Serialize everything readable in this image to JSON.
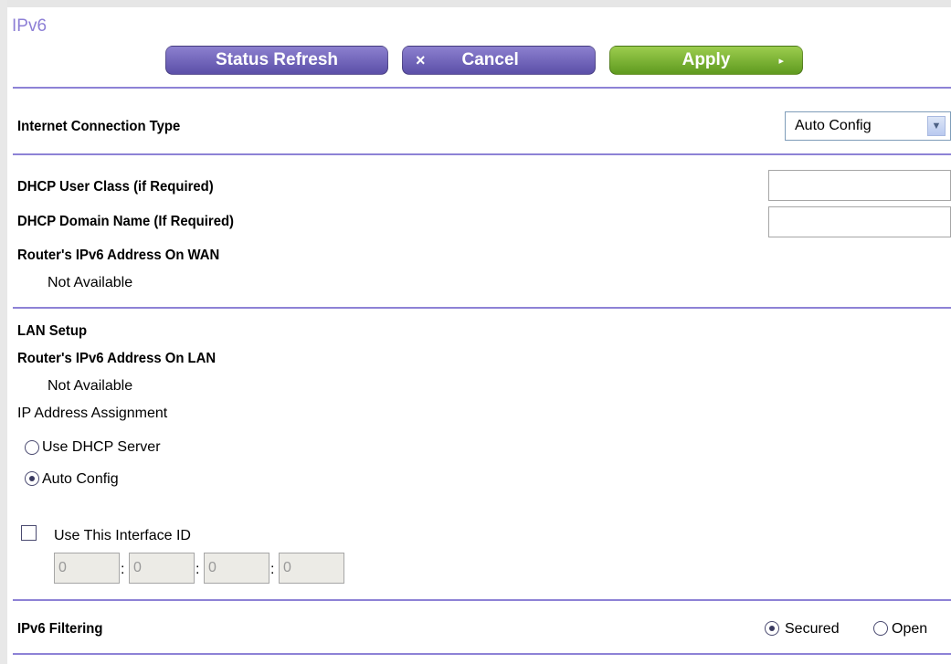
{
  "page": {
    "title": "IPv6"
  },
  "toolbar": {
    "refresh_label": "Status Refresh",
    "cancel_label": "Cancel",
    "cancel_icon": "×",
    "apply_label": "Apply",
    "apply_icon": "▸"
  },
  "connection": {
    "label": "Internet Connection Type",
    "selected": "Auto Config"
  },
  "dhcp": {
    "user_class_label": "DHCP User Class (if Required)",
    "user_class_value": "",
    "domain_label": "DHCP Domain Name  (If Required)",
    "domain_value": "",
    "wan_addr_label": "Router's IPv6 Address On WAN",
    "wan_addr_value": "Not Available"
  },
  "lan": {
    "section_label": "LAN Setup",
    "addr_label": "Router's IPv6 Address On LAN",
    "addr_value": "Not Available",
    "assignment_label": "IP Address Assignment",
    "options": [
      {
        "label": "Use DHCP Server",
        "checked": false
      },
      {
        "label": "Auto Config",
        "checked": true
      }
    ],
    "interface_id_label": "Use This Interface ID",
    "interface_id_checked": false,
    "interface_id_values": [
      "0",
      "0",
      "0",
      "0"
    ],
    "separator": ":"
  },
  "filtering": {
    "label": "IPv6 Filtering",
    "options": [
      {
        "label": "Secured",
        "checked": true
      },
      {
        "label": "Open",
        "checked": false
      }
    ]
  },
  "colors": {
    "accent": "#8d82d6",
    "apply": "#7bb536",
    "button": "#6f63bd"
  }
}
